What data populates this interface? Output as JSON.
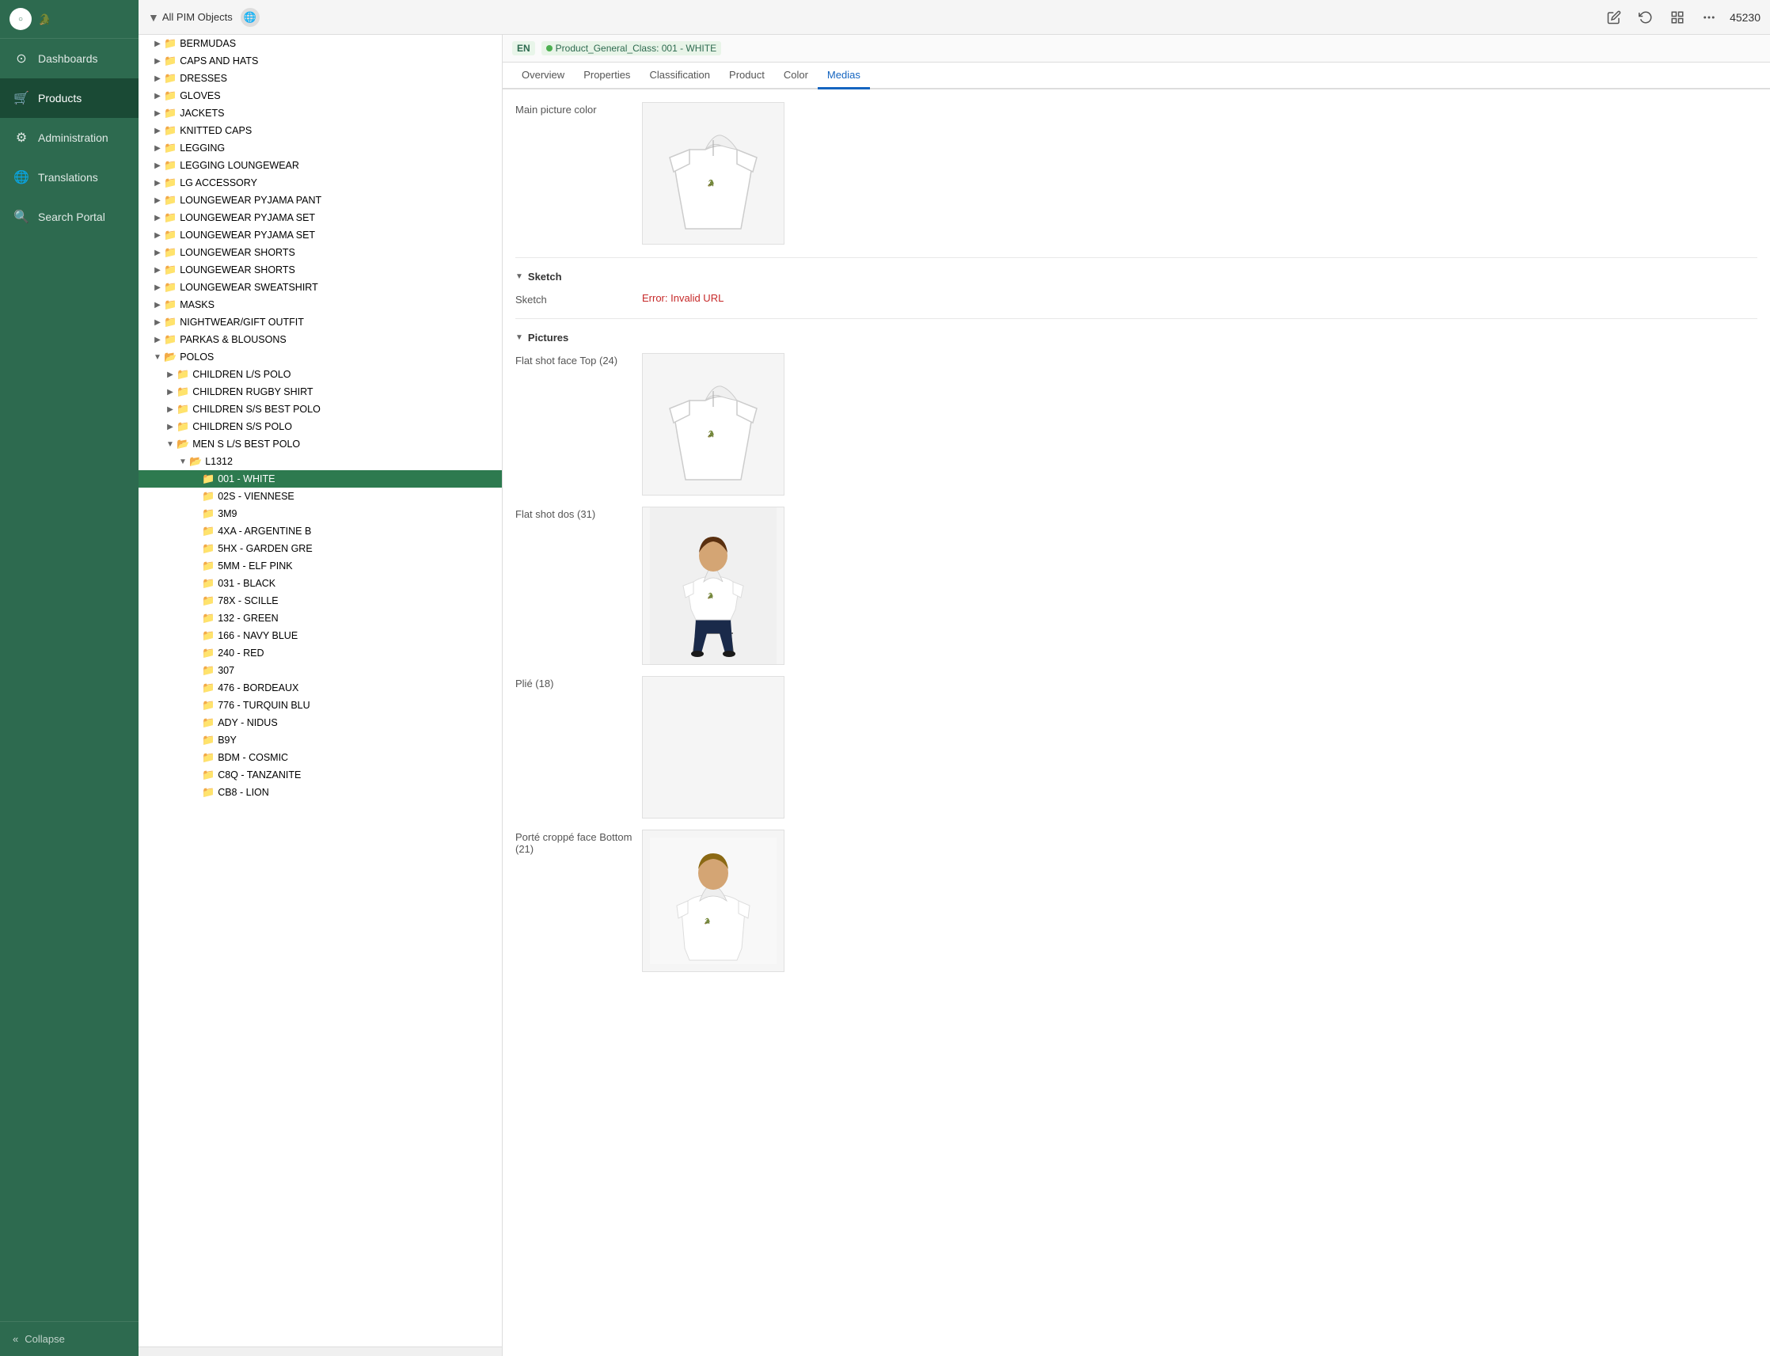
{
  "sidebar": {
    "logo_text": "LACOSTE",
    "items": [
      {
        "id": "dashboards",
        "label": "Dashboards",
        "icon": "⊙",
        "active": false
      },
      {
        "id": "products",
        "label": "Products",
        "icon": "🛒",
        "active": true
      },
      {
        "id": "administration",
        "label": "Administration",
        "icon": "⚙",
        "active": false
      },
      {
        "id": "translations",
        "label": "Translations",
        "icon": "🌐",
        "active": false
      },
      {
        "id": "search-portal",
        "label": "Search Portal",
        "icon": "🔍",
        "active": false
      }
    ],
    "collapse_label": "Collapse"
  },
  "toolbar": {
    "filter_label": "All PIM Objects",
    "item_number": "45230",
    "icons": [
      "edit",
      "refresh",
      "layout",
      "more"
    ]
  },
  "detail_header": {
    "lang": "EN",
    "class_label": "Product_General_Class: 001 - WHITE"
  },
  "tabs": [
    {
      "id": "overview",
      "label": "Overview"
    },
    {
      "id": "properties",
      "label": "Properties"
    },
    {
      "id": "classification",
      "label": "Classification"
    },
    {
      "id": "product",
      "label": "Product"
    },
    {
      "id": "color",
      "label": "Color"
    },
    {
      "id": "medias",
      "label": "Medias",
      "active": true
    }
  ],
  "tree_items": [
    {
      "id": "bermudas",
      "label": "BERMUDAS",
      "indent": 1,
      "has_children": true,
      "expanded": false
    },
    {
      "id": "caps-hats",
      "label": "CAPS AND HATS",
      "indent": 1,
      "has_children": true,
      "expanded": false
    },
    {
      "id": "dresses",
      "label": "DRESSES",
      "indent": 1,
      "has_children": true,
      "expanded": false
    },
    {
      "id": "gloves",
      "label": "GLOVES",
      "indent": 1,
      "has_children": true,
      "expanded": false
    },
    {
      "id": "jackets",
      "label": "JACKETS",
      "indent": 1,
      "has_children": true,
      "expanded": false
    },
    {
      "id": "knitted-caps",
      "label": "KNITTED CAPS",
      "indent": 1,
      "has_children": true,
      "expanded": false
    },
    {
      "id": "legging",
      "label": "LEGGING",
      "indent": 1,
      "has_children": true,
      "expanded": false
    },
    {
      "id": "legging-loungewear",
      "label": "LEGGING LOUNGEWEAR",
      "indent": 1,
      "has_children": true,
      "expanded": false
    },
    {
      "id": "lg-accessory",
      "label": "LG ACCESSORY",
      "indent": 1,
      "has_children": true,
      "expanded": false
    },
    {
      "id": "loungewear-pyjama-pant",
      "label": "LOUNGEWEAR PYJAMA PANT",
      "indent": 1,
      "has_children": true,
      "expanded": false
    },
    {
      "id": "loungewear-pyjama-set",
      "label": "LOUNGEWEAR PYJAMA SET",
      "indent": 1,
      "has_children": true,
      "expanded": false
    },
    {
      "id": "loungewear-pyjama-set2",
      "label": "LOUNGEWEAR PYJAMA SET",
      "indent": 1,
      "has_children": true,
      "expanded": false
    },
    {
      "id": "loungewear-shorts",
      "label": "LOUNGEWEAR SHORTS",
      "indent": 1,
      "has_children": true,
      "expanded": false
    },
    {
      "id": "loungewear-shorts2",
      "label": "LOUNGEWEAR SHORTS",
      "indent": 1,
      "has_children": true,
      "expanded": false
    },
    {
      "id": "loungewear-sweatshirt",
      "label": "LOUNGEWEAR SWEATSHIRT",
      "indent": 1,
      "has_children": true,
      "expanded": false
    },
    {
      "id": "masks",
      "label": "MASKS",
      "indent": 1,
      "has_children": true,
      "expanded": false
    },
    {
      "id": "nightwear-gift",
      "label": "NIGHTWEAR/GIFT OUTFIT",
      "indent": 1,
      "has_children": true,
      "expanded": false
    },
    {
      "id": "parkas-blousons",
      "label": "PARKAS & BLOUSONS",
      "indent": 1,
      "has_children": true,
      "expanded": false
    },
    {
      "id": "polos",
      "label": "POLOS",
      "indent": 1,
      "has_children": true,
      "expanded": true
    },
    {
      "id": "children-ls-polo",
      "label": "CHILDREN L/S POLO",
      "indent": 2,
      "has_children": true,
      "expanded": false
    },
    {
      "id": "children-rugby-shirt",
      "label": "CHILDREN RUGBY SHIRT",
      "indent": 2,
      "has_children": true,
      "expanded": false
    },
    {
      "id": "children-ss-best-polo",
      "label": "CHILDREN S/S BEST POLO",
      "indent": 2,
      "has_children": true,
      "expanded": false
    },
    {
      "id": "children-ss-polo",
      "label": "CHILDREN S/S POLO",
      "indent": 2,
      "has_children": true,
      "expanded": false
    },
    {
      "id": "men-s-ls-best-polo",
      "label": "MEN S L/S BEST POLO",
      "indent": 2,
      "has_children": true,
      "expanded": true
    },
    {
      "id": "l1312",
      "label": "L1312",
      "indent": 3,
      "has_children": true,
      "expanded": true
    },
    {
      "id": "001-white",
      "label": "001 - WHITE",
      "indent": 4,
      "has_children": false,
      "selected": true
    },
    {
      "id": "02s-viennese",
      "label": "02S - VIENNESE",
      "indent": 4,
      "has_children": false
    },
    {
      "id": "3m9",
      "label": "3M9",
      "indent": 4,
      "has_children": false
    },
    {
      "id": "4xa-argentine-b",
      "label": "4XA - ARGENTINE B",
      "indent": 4,
      "has_children": false
    },
    {
      "id": "5hx-garden-gre",
      "label": "5HX - GARDEN GRE",
      "indent": 4,
      "has_children": false
    },
    {
      "id": "5mm-elf-pink",
      "label": "5MM - ELF PINK",
      "indent": 4,
      "has_children": false
    },
    {
      "id": "031-black",
      "label": "031 - BLACK",
      "indent": 4,
      "has_children": false
    },
    {
      "id": "78x-scille",
      "label": "78X - SCILLE",
      "indent": 4,
      "has_children": false
    },
    {
      "id": "132-green",
      "label": "132 - GREEN",
      "indent": 4,
      "has_children": false
    },
    {
      "id": "166-navy-blue",
      "label": "166 - NAVY BLUE",
      "indent": 4,
      "has_children": false
    },
    {
      "id": "240-red",
      "label": "240 - RED",
      "indent": 4,
      "has_children": false
    },
    {
      "id": "307",
      "label": "307",
      "indent": 4,
      "has_children": false
    },
    {
      "id": "476-bordeaux",
      "label": "476 - BORDEAUX",
      "indent": 4,
      "has_children": false
    },
    {
      "id": "776-turquin-blu",
      "label": "776 - TURQUIN BLU",
      "indent": 4,
      "has_children": false
    },
    {
      "id": "ady-nidus",
      "label": "ADY - NIDUS",
      "indent": 4,
      "has_children": false
    },
    {
      "id": "b9y",
      "label": "B9Y",
      "indent": 4,
      "has_children": false
    },
    {
      "id": "bdm-cosmic",
      "label": "BDM - COSMIC",
      "indent": 4,
      "has_children": false
    },
    {
      "id": "c8q-tanzanite",
      "label": "C8Q - TANZANITE",
      "indent": 4,
      "has_children": false
    },
    {
      "id": "cb8-lion",
      "label": "CB8 - LION",
      "indent": 4,
      "has_children": false
    }
  ],
  "medias": {
    "main_picture_section": "Main picture color",
    "sketch_section": "Sketch",
    "sketch_label": "Sketch",
    "sketch_error": "Error: Invalid URL",
    "pictures_section": "Pictures",
    "flat_shot_top_label": "Flat shot face Top (24)",
    "flat_shot_dos_label": "Flat shot dos (31)",
    "plie_label": "Plié (18)",
    "porte_croppe_label": "Porté croppé face Bottom (21)"
  }
}
